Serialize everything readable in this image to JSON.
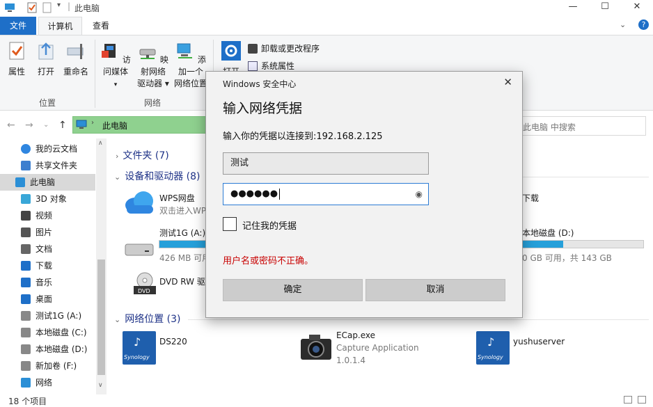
{
  "titlebar": {
    "title": "此电脑",
    "min": "—",
    "max": "☐",
    "close": "✕"
  },
  "tabs": {
    "file": "文件",
    "computer": "计算机",
    "view": "查看"
  },
  "ribbon": {
    "properties": "属性",
    "open": "打开",
    "rename": "重命名",
    "group_location": "位置",
    "access_media": "访问媒体",
    "map_drive_1": "映射网络",
    "map_drive_2": "驱动器 ▾",
    "add_location_1": "添加一个",
    "add_location_2": "网络位置",
    "group_network": "网络",
    "open_settings": "打开",
    "uninstall": "卸载或更改程序",
    "system_props": "系统属性"
  },
  "address": {
    "path": "此电脑",
    "search_placeholder": "此电脑 中搜索"
  },
  "nav": {
    "items": [
      {
        "label": "我的云文档",
        "icon": "cloud-icon"
      },
      {
        "label": "共享文件夹",
        "icon": "shared-folder-icon"
      },
      {
        "label": "此电脑",
        "icon": "computer-icon"
      },
      {
        "label": "3D 对象",
        "icon": "cube-icon"
      },
      {
        "label": "视频",
        "icon": "video-icon"
      },
      {
        "label": "图片",
        "icon": "picture-icon"
      },
      {
        "label": "文档",
        "icon": "document-icon"
      },
      {
        "label": "下载",
        "icon": "download-icon"
      },
      {
        "label": "音乐",
        "icon": "music-icon"
      },
      {
        "label": "桌面",
        "icon": "desktop-icon"
      },
      {
        "label": "测试1G (A:)",
        "icon": "drive-icon"
      },
      {
        "label": "本地磁盘 (C:)",
        "icon": "drive-icon"
      },
      {
        "label": "本地磁盘 (D:)",
        "icon": "drive-icon"
      },
      {
        "label": "新加卷 (F:)",
        "icon": "drive-icon"
      },
      {
        "label": "网络",
        "icon": "network-icon"
      }
    ]
  },
  "main": {
    "folders": "文件夹 (7)",
    "devices": "设备和驱动器 (8)",
    "wps_title": "WPS网盘",
    "wps_sub": "双击进入WPS网盘",
    "drive_a_title": "测试1G (A:)",
    "drive_a_sub": "426 MB 可用，共 1.00 GB",
    "drive_a_fill": 0.58,
    "dvd_title": "DVD RW 驱动器 (E:)",
    "download_title": "下载",
    "drive_d_title": "本地磁盘 (D:)",
    "drive_d_sub": "0 GB 可用，共 143 GB",
    "drive_d_fill": 0.34,
    "network": "网络位置 (3)",
    "net1": "DS220",
    "net2_title": "ECap.exe",
    "net2_sub1": "Capture Application",
    "net2_sub2": "1.0.1.4",
    "net3": "yushuserver",
    "synology_label": "Synology"
  },
  "status": {
    "count": "18 个项目"
  },
  "dialog": {
    "title": "Windows 安全中心",
    "heading": "输入网络凭据",
    "desc": "输入你的凭据以连接到:192.168.2.125",
    "username": "测试",
    "password": "●●●●●●",
    "remember": "记住我的凭据",
    "error": "用户名或密码不正确。",
    "ok": "确定",
    "cancel": "取消",
    "close": "✕"
  }
}
